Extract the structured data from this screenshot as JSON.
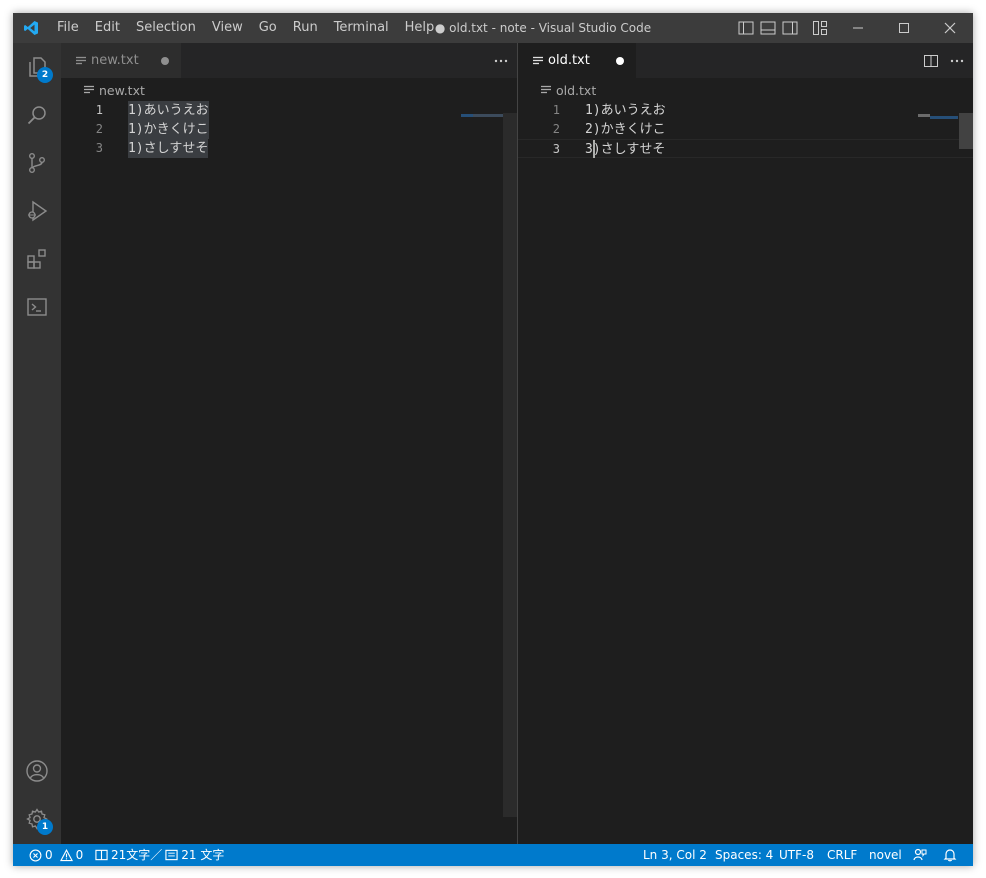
{
  "app": {
    "window_title": "● old.txt - note - Visual Studio Code",
    "menu": [
      "File",
      "Edit",
      "Selection",
      "View",
      "Go",
      "Run",
      "Terminal",
      "Help"
    ]
  },
  "activity_bar": {
    "explorer_badge": "2",
    "settings_badge": "1"
  },
  "editors": {
    "left": {
      "tab_label": "new.txt",
      "breadcrumb": "new.txt",
      "lines": [
        {
          "num": "1",
          "text": "1)あいうえお"
        },
        {
          "num": "2",
          "text": "1)かきくけこ"
        },
        {
          "num": "3",
          "text": "1)さしすせそ"
        }
      ]
    },
    "right": {
      "tab_label": "old.txt",
      "breadcrumb": "old.txt",
      "lines": [
        {
          "num": "1",
          "text": "1)あいうえお"
        },
        {
          "num": "2",
          "text": "2)かきくけこ"
        },
        {
          "num": "3",
          "text": "3)さしすせそ"
        }
      ]
    }
  },
  "status_bar": {
    "errors": "0",
    "warnings": "0",
    "char_count": "21文字／",
    "char_count_2": "21 文字",
    "position": "Ln 3, Col 2",
    "indent": "Spaces: 4",
    "encoding": "UTF-8",
    "eol": "CRLF",
    "language": "novel"
  },
  "colors": {
    "accent": "#007acc",
    "titlebar": "#3c3c3c",
    "activity_bar": "#333333",
    "editor_bg": "#1e1e1e",
    "vscode_logo": "#23a9f2"
  }
}
